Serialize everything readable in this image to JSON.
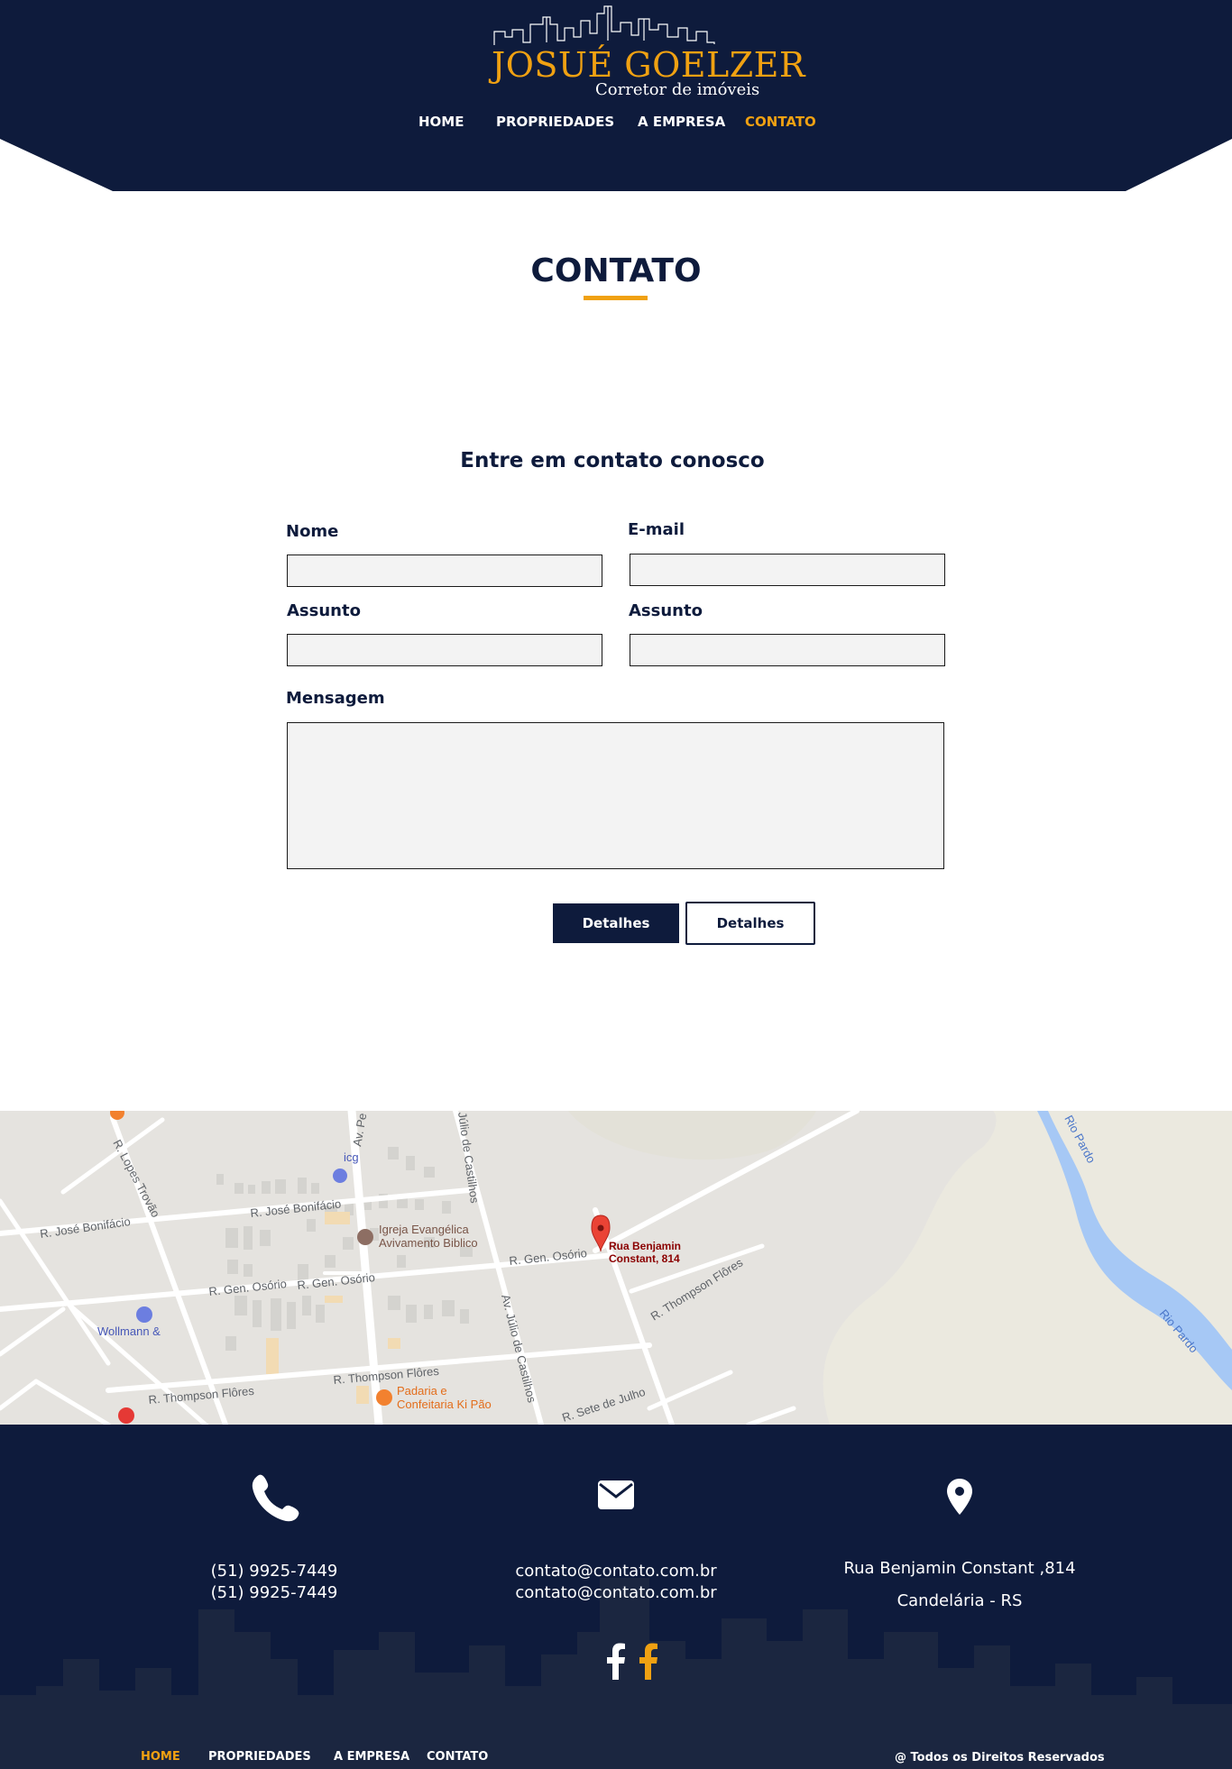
{
  "header": {
    "brand_name": "JOSUÉ GOELZER",
    "brand_tagline": "Corretor de imóveis",
    "nav": [
      {
        "label": "HOME"
      },
      {
        "label": "PROPRIEDADES"
      },
      {
        "label": "A EMPRESA"
      },
      {
        "label": "CONTATO",
        "active": true
      }
    ]
  },
  "contact": {
    "title": "CONTATO",
    "form_heading": "Entre em contato conosco",
    "fields": {
      "name_label": "Nome",
      "email_label": "E-mail",
      "subject_label": "Assunto",
      "subject2_label": "Assunto",
      "message_label": "Mensagem",
      "name_value": "",
      "email_value": "",
      "subject_value": "",
      "subject2_value": "",
      "message_value": ""
    },
    "buttons": {
      "primary_label": "Detalhes",
      "secondary_label": "Detalhes"
    }
  },
  "map": {
    "marker_label_line1": "Rua Benjamin",
    "marker_label_line2": "Constant, 814",
    "streets": [
      "R. José Bonifácio",
      "R. José Bonifácio",
      "R. Gen. Osório",
      "R. Gen. Osório",
      "R. Gen. Osório",
      "R. Thompson Flôres",
      "R. Thompson Flôres",
      "R. Thompson Flôres",
      "R. Lopes Trovão",
      "Av. Júlio de Castilhos",
      "Júlio de Castilhos",
      "R. Sete de Julho",
      "Av. Pe",
      "Rio Pardo",
      "Rio Pardo"
    ],
    "places": {
      "church_line1": "Igreja Evangélica",
      "church_line2": "Avivamento Biblico",
      "bakery_line1": "Padaria e",
      "bakery_line2": "Confeitaria Ki Pão",
      "store": "Wollmann &",
      "icg": "icg"
    }
  },
  "footer": {
    "phone_1": "(51) 9925-7449",
    "phone_2": "(51) 9925-7449",
    "email_1": "contato@contato.com.br",
    "email_2": "contato@contato.com.br",
    "address_line1": "Rua Benjamin Constant ,814",
    "address_line2": "Candelária - RS",
    "nav": [
      {
        "label": "HOME",
        "active": true
      },
      {
        "label": "PROPRIEDADES"
      },
      {
        "label": "A EMPRESA"
      },
      {
        "label": "CONTATO"
      }
    ],
    "copyright": "@ Todos os Direitos Reservados"
  },
  "colors": {
    "navy": "#0e1b3c",
    "gold": "#f0a112",
    "input_bg": "#f3f3f3"
  },
  "icons": [
    "skyline-logo",
    "phone-icon",
    "envelope-icon",
    "map-pin-icon",
    "facebook-icon",
    "facebook-icon-gold"
  ]
}
